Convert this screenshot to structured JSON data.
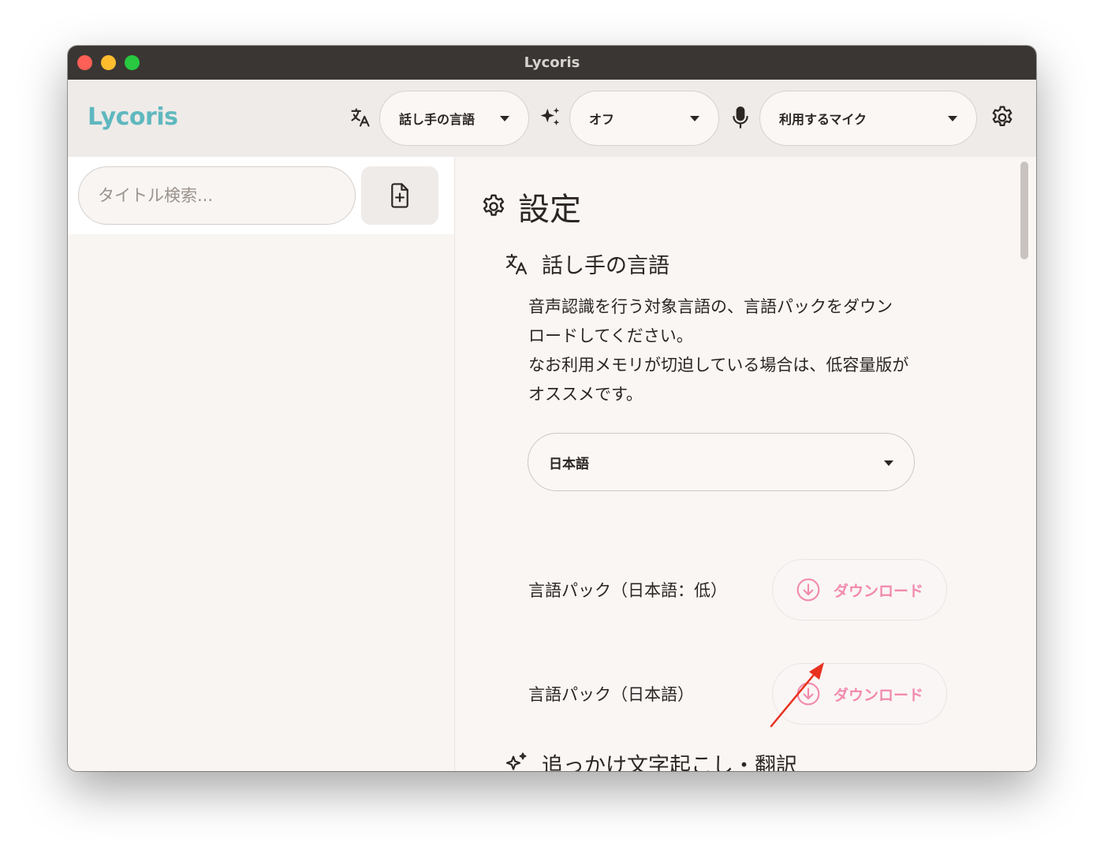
{
  "window": {
    "title": "Lycoris"
  },
  "toolbar": {
    "brand": "Lycoris",
    "speaker_language": "話し手の言語",
    "mode": "オフ",
    "microphone": "利用するマイク"
  },
  "sidebar": {
    "search_placeholder": "タイトル検索..."
  },
  "settings": {
    "title": "設定",
    "speaker_section": {
      "title": "話し手の言語",
      "description_lines": [
        "音声認識を行う対象言語の、言語パックをダウン",
        "ロードしてください。",
        "なお利用メモリが切迫している場合は、低容量版が",
        "オススメです。"
      ],
      "selected_language": "日本語",
      "packs": [
        {
          "label": "言語パック（日本語：低）",
          "button": "ダウンロード"
        },
        {
          "label": "言語パック（日本語）",
          "button": "ダウンロード"
        }
      ]
    },
    "next_section_title": "追っかけ文字起こし・翻訳"
  },
  "colors": {
    "brand": "#5fb8bf",
    "download_accent": "#f28aae",
    "annotation_arrow": "#e8311f"
  }
}
